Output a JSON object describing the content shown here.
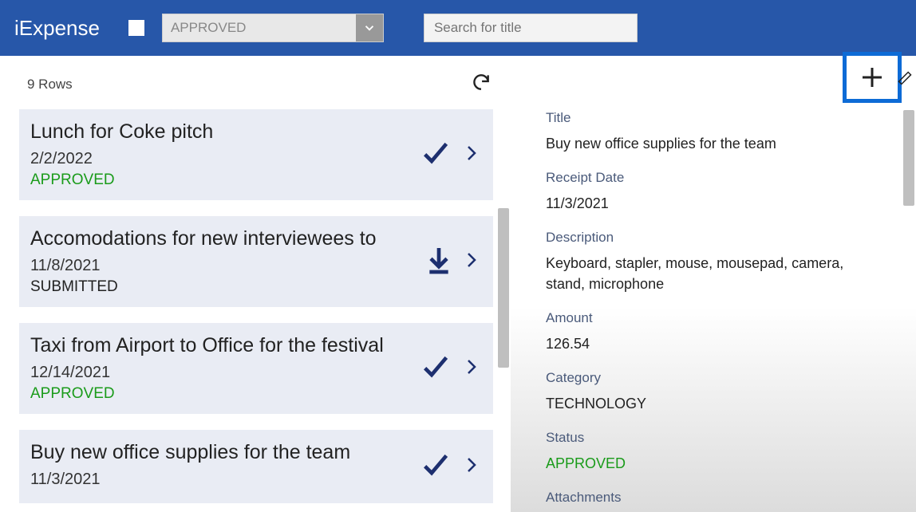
{
  "header": {
    "app_title": "iExpense",
    "filter_value": "APPROVED",
    "search_placeholder": "Search for title"
  },
  "list": {
    "rows_label": "9 Rows",
    "items": [
      {
        "title": "Lunch for Coke pitch",
        "date": "2/2/2022",
        "status": "APPROVED",
        "status_kind": "approved",
        "icon": "check"
      },
      {
        "title": "Accomodations for new interviewees to",
        "date": "11/8/2021",
        "status": "SUBMITTED",
        "status_kind": "submitted",
        "icon": "download"
      },
      {
        "title": "Taxi from Airport to Office for the festival",
        "date": "12/14/2021",
        "status": "APPROVED",
        "status_kind": "approved",
        "icon": "check"
      },
      {
        "title": "Buy new office supplies for the team",
        "date": "11/3/2021",
        "status": "",
        "status_kind": "approved",
        "icon": "check"
      }
    ]
  },
  "detail": {
    "labels": {
      "title": "Title",
      "receipt_date": "Receipt Date",
      "description": "Description",
      "amount": "Amount",
      "category": "Category",
      "status": "Status",
      "attachments": "Attachments"
    },
    "title": "Buy new office supplies for the team",
    "receipt_date": "11/3/2021",
    "description": "Keyboard, stapler, mouse, mousepad, camera, stand, microphone",
    "amount": "126.54",
    "category": "TECHNOLOGY",
    "status": "APPROVED"
  }
}
